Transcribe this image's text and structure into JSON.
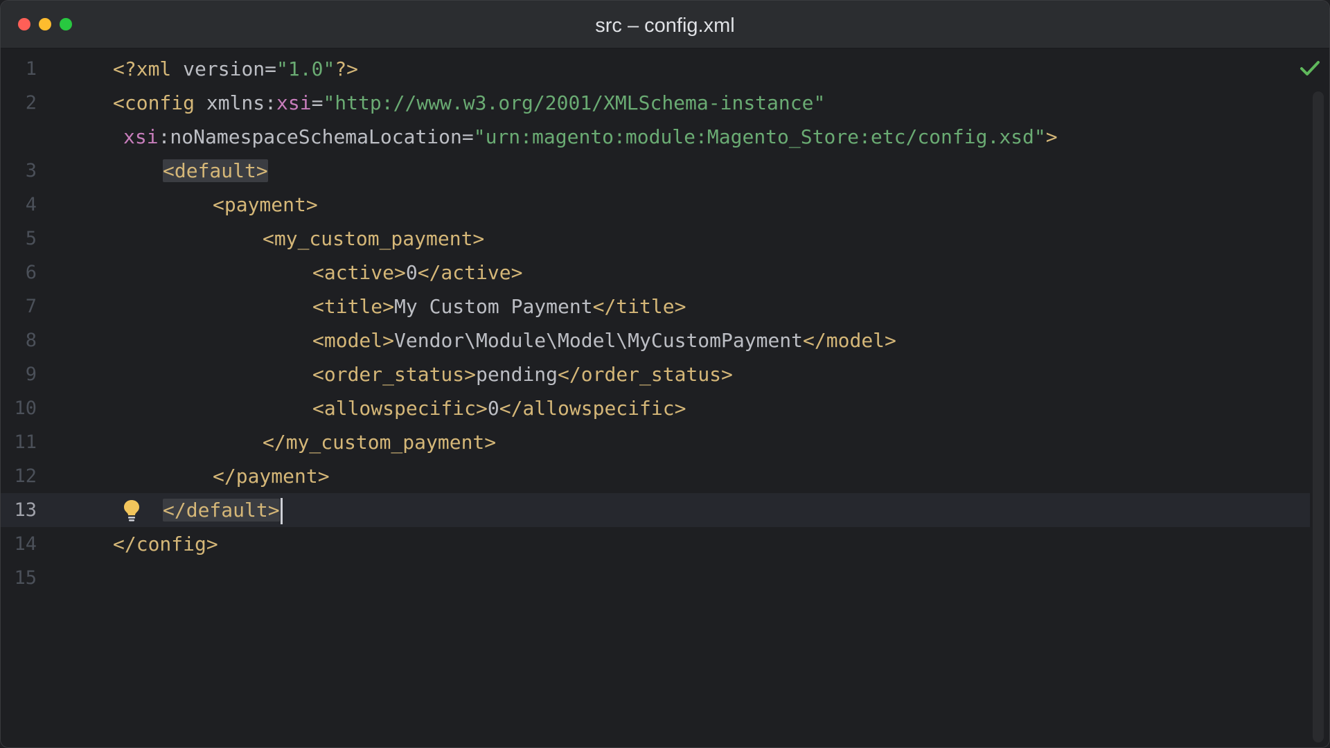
{
  "window": {
    "title": "src – config.xml"
  },
  "editor": {
    "lines": [
      {
        "number": "1"
      },
      {
        "number": "2"
      },
      {
        "number": ""
      },
      {
        "number": "3"
      },
      {
        "number": "4"
      },
      {
        "number": "5"
      },
      {
        "number": "6"
      },
      {
        "number": "7"
      },
      {
        "number": "8"
      },
      {
        "number": "9"
      },
      {
        "number": "10"
      },
      {
        "number": "11"
      },
      {
        "number": "12"
      },
      {
        "number": "13"
      },
      {
        "number": "14"
      },
      {
        "number": "15"
      }
    ],
    "code": {
      "l1_open": "<?xml ",
      "l1_attr": "version=",
      "l1_val": "\"1.0\"",
      "l1_close": "?>",
      "l2_open": "<config ",
      "l2_attr": "xmlns:",
      "l2_ns": "xsi",
      "l2_eq": "=",
      "l2_val": "\"http://www.w3.org/2001/XMLSchema-instance\"",
      "l2b_ns": "xsi",
      "l2b_attr": ":noNamespaceSchemaLocation=",
      "l2b_val": "\"urn:magento:module:Magento_Store:etc/config.xsd\"",
      "l2b_close": ">",
      "l3": "<default>",
      "l4": "<payment>",
      "l5": "<my_custom_payment>",
      "l6_open": "<active>",
      "l6_text": "0",
      "l6_close": "</active>",
      "l7_open": "<title>",
      "l7_text": "My Custom Payment",
      "l7_close": "</title>",
      "l8_open": "<model>",
      "l8_text": "Vendor\\Module\\Model\\MyCustomPayment",
      "l8_close": "</model>",
      "l9_open": "<order_status>",
      "l9_text": "pending",
      "l9_close": "</order_status>",
      "l10_open": "<allowspecific>",
      "l10_text": "0",
      "l10_close": "</allowspecific>",
      "l11": "</my_custom_payment>",
      "l12": "</payment>",
      "l13": "</default>",
      "l14": "</config>"
    }
  },
  "icons": {
    "bulb": "lightbulb-icon",
    "status": "checkmark-icon"
  },
  "colors": {
    "tag": "#d5b778",
    "namespace": "#c77dbb",
    "string": "#6aab73",
    "text": "#bcbec4",
    "background": "#1e1f22",
    "check": "#5fb85c",
    "bulb": "#f2c55c"
  }
}
